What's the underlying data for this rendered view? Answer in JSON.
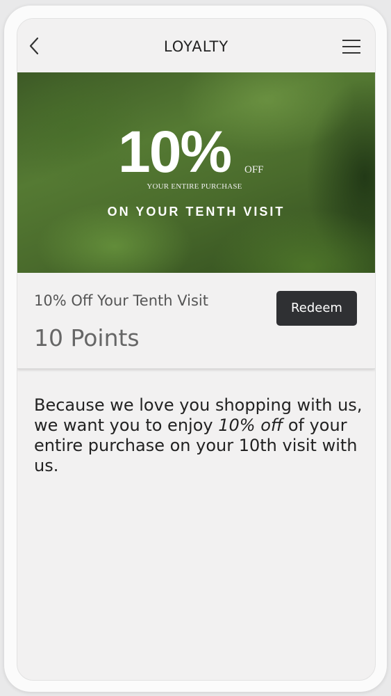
{
  "header": {
    "title": "LOYALTY",
    "back_icon": "chevron-left-icon",
    "menu_icon": "hamburger-menu-icon"
  },
  "hero": {
    "percent": "10%",
    "off": "OFF",
    "subtitle": "YOUR ENTIRE PURCHASE",
    "visit": "ON YOUR TENTH VISIT"
  },
  "reward": {
    "title": "10% Off Your Tenth Visit",
    "points": "10 Points",
    "redeem_label": "Redeem"
  },
  "description": {
    "part1": "Because we love you shopping with us, we want you to enjoy ",
    "emphasis": "10% off",
    "part2": " of your entire purchase on your 10th visit with us."
  },
  "colors": {
    "button_bg": "#2f3033",
    "screen_bg": "#f2f1f1"
  }
}
